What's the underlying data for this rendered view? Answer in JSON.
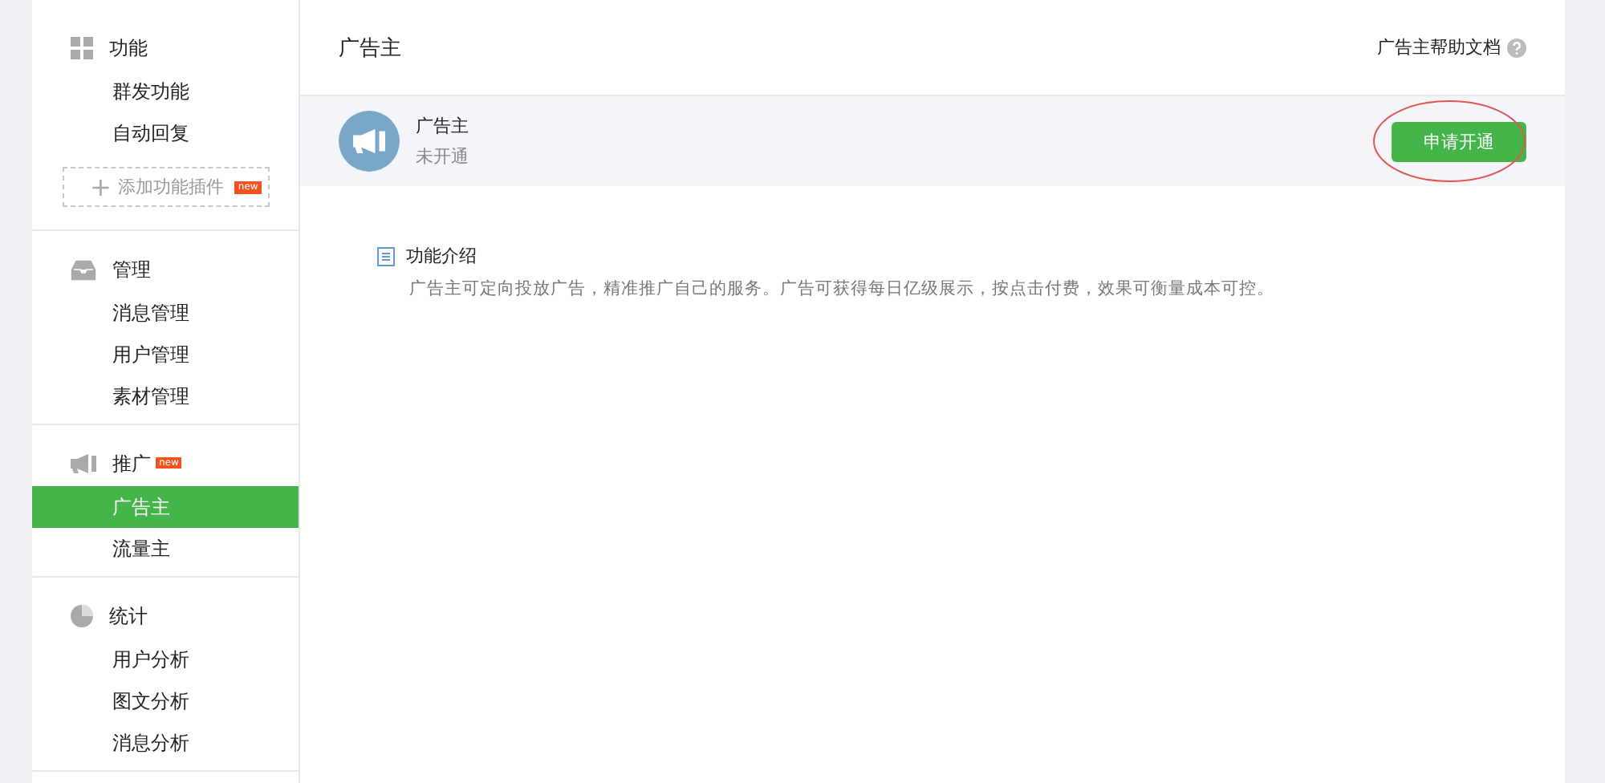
{
  "sidebar": {
    "groups": [
      {
        "title": "功能",
        "items": [
          {
            "label": "群发功能",
            "selected": false
          },
          {
            "label": "自动回复",
            "selected": false
          }
        ],
        "add_button": {
          "icon": "+",
          "label": "添加功能插件",
          "badge": "new"
        }
      },
      {
        "title": "管理",
        "items": [
          {
            "label": "消息管理",
            "selected": false
          },
          {
            "label": "用户管理",
            "selected": false
          },
          {
            "label": "素材管理",
            "selected": false
          }
        ]
      },
      {
        "title": "推广",
        "badge": "new",
        "items": [
          {
            "label": "广告主",
            "selected": true
          },
          {
            "label": "流量主",
            "selected": false
          }
        ]
      },
      {
        "title": "统计",
        "items": [
          {
            "label": "用户分析",
            "selected": false
          },
          {
            "label": "图文分析",
            "selected": false
          },
          {
            "label": "消息分析",
            "selected": false
          }
        ]
      }
    ]
  },
  "main": {
    "title": "广告主",
    "help_link": "广告主帮助文档",
    "service": {
      "name": "广告主",
      "status": "未开通",
      "button": "申请开通"
    },
    "intro": {
      "title": "功能介绍",
      "text": "广告主可定向投放广告，精准推广自己的服务。广告可获得每日亿级展示，按点击付费，效果可衡量成本可控。"
    }
  }
}
